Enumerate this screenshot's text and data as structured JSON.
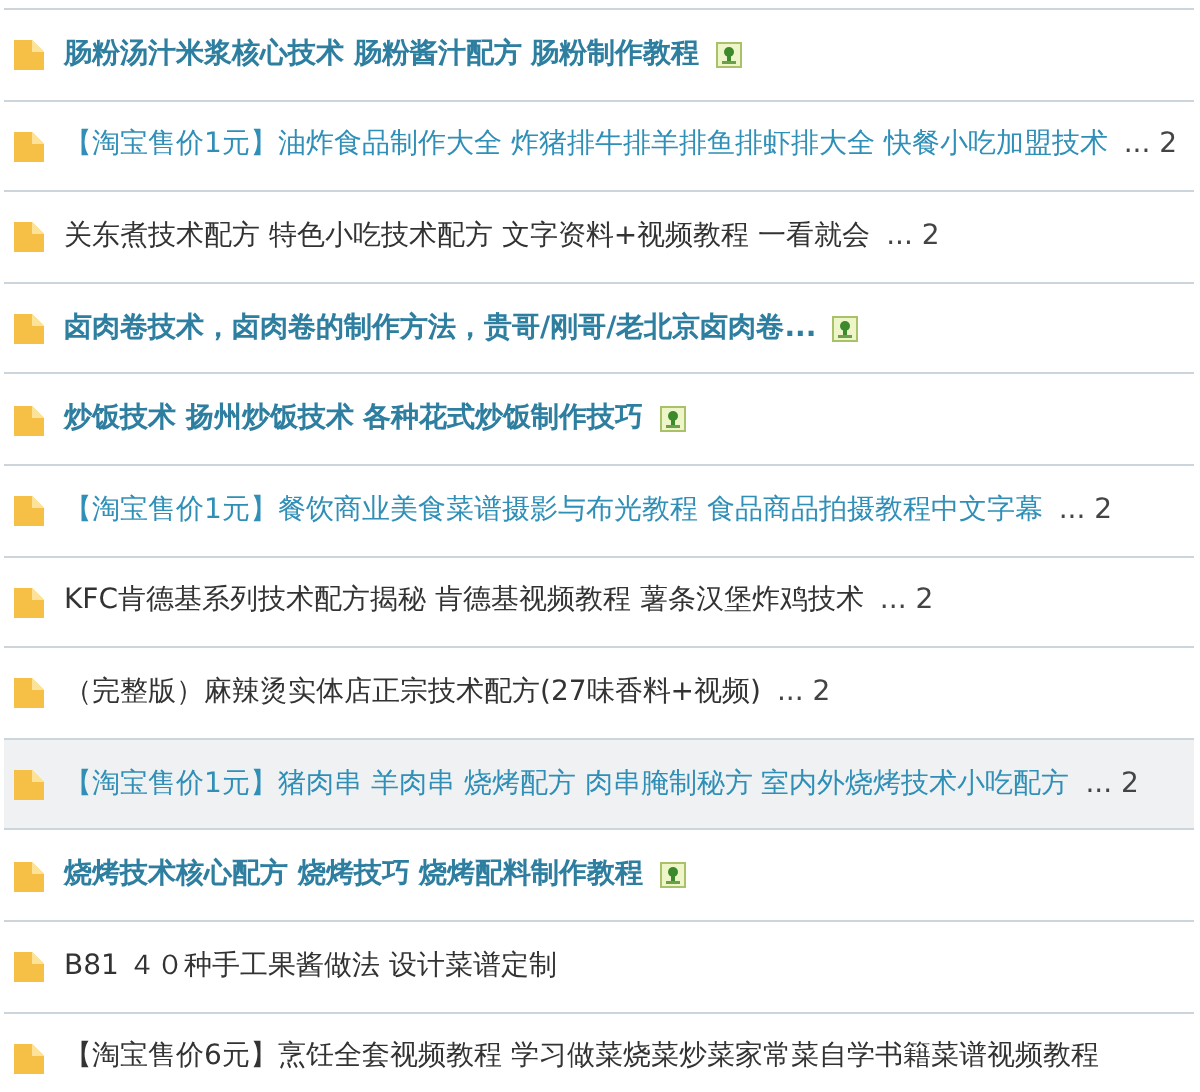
{
  "threads": [
    {
      "title": "肠粉汤汁米浆核心技术 肠粉酱汁配方 肠粉制作教程",
      "kind": "bold",
      "attachment": true,
      "selected": false
    },
    {
      "title": "【淘宝售价1元】油炸食品制作大全 炸猪排牛排羊排鱼排虾排大全 快餐小吃加盟技术",
      "kind": "link",
      "more": "...",
      "page": "2",
      "attachment": false,
      "selected": false
    },
    {
      "title": "关东煮技术配方 特色小吃技术配方 文字资料+视频教程 一看就会",
      "kind": "plain",
      "more": "...",
      "page": "2",
      "attachment": false,
      "selected": false
    },
    {
      "title": "卤肉卷技术，卤肉卷的制作方法，贵哥/刚哥/老北京卤肉卷...",
      "kind": "bold",
      "attachment": true,
      "selected": false
    },
    {
      "title": "炒饭技术 扬州炒饭技术 各种花式炒饭制作技巧",
      "kind": "bold",
      "attachment": true,
      "selected": false
    },
    {
      "title": "【淘宝售价1元】餐饮商业美食菜谱摄影与布光教程 食品商品拍摄教程中文字幕",
      "kind": "link",
      "more": "...",
      "page": "2",
      "attachment": false,
      "selected": false
    },
    {
      "title": "KFC肯德基系列技术配方揭秘 肯德基视频教程 薯条汉堡炸鸡技术",
      "kind": "plain",
      "more": "...",
      "page": "2",
      "attachment": false,
      "selected": false
    },
    {
      "title": "（完整版）麻辣烫实体店正宗技术配方(27味香料+视频)",
      "kind": "plain",
      "more": "...",
      "page": "2",
      "attachment": false,
      "selected": false
    },
    {
      "title": "【淘宝售价1元】猪肉串 羊肉串 烧烤配方 肉串腌制秘方 室内外烧烤技术小吃配方",
      "kind": "link",
      "more": "...",
      "page": "2",
      "attachment": false,
      "selected": true
    },
    {
      "title": "烧烤技术核心配方 烧烤技巧 烧烤配料制作教程",
      "kind": "bold",
      "attachment": true,
      "selected": false
    },
    {
      "title": "B81 ４０种手工果酱做法 设计菜谱定制",
      "kind": "plain",
      "attachment": false,
      "selected": false
    },
    {
      "title": "【淘宝售价6元】烹饪全套视频教程 学习做菜烧菜炒菜家常菜自学书籍菜谱视频教程",
      "kind": "plain",
      "attachment": false,
      "selected": false
    }
  ]
}
